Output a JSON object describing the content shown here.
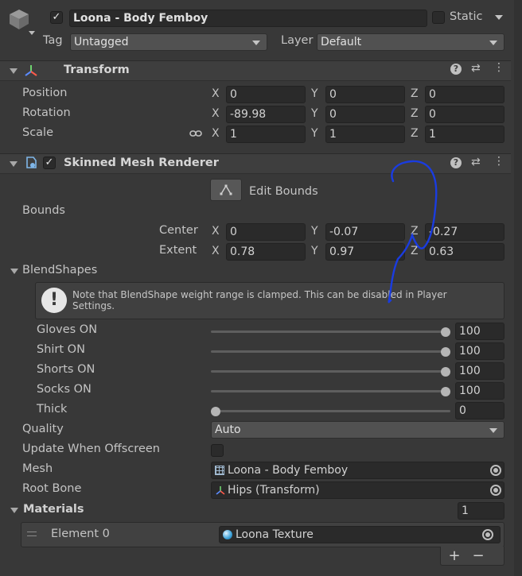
{
  "header": {
    "object_name": "Loona - Body Femboy",
    "active_checked": "✓",
    "static_label": "Static",
    "tag_label": "Tag",
    "tag_value": "Untagged",
    "layer_label": "Layer",
    "layer_value": "Default"
  },
  "transform": {
    "title": "Transform",
    "position_label": "Position",
    "rotation_label": "Rotation",
    "scale_label": "Scale",
    "x_label": "X",
    "y_label": "Y",
    "z_label": "Z",
    "position": {
      "x": "0",
      "y": "0",
      "z": "0"
    },
    "rotation": {
      "x": "-89.98",
      "y": "0",
      "z": "0"
    },
    "scale": {
      "x": "1",
      "y": "1",
      "z": "1"
    }
  },
  "renderer": {
    "title": "Skinned Mesh Renderer",
    "checked": "✓",
    "edit_bounds_label": "Edit Bounds",
    "bounds_label": "Bounds",
    "center_label": "Center",
    "extent_label": "Extent",
    "center": {
      "x": "0",
      "y": "-0.07",
      "z": "-0.27"
    },
    "extent": {
      "x": "0.78",
      "y": "0.97",
      "z": "0.63"
    },
    "blendshapes_label": "BlendShapes",
    "note": "Note that BlendShape weight range is clamped. This can be disabled in Player Settings.",
    "note_icon": "!",
    "blendshapes": [
      {
        "name": "Gloves ON",
        "value": "100",
        "level": 1.0
      },
      {
        "name": "Shirt ON",
        "value": "100",
        "level": 1.0
      },
      {
        "name": "Shorts ON",
        "value": "100",
        "level": 1.0
      },
      {
        "name": "Socks ON",
        "value": "100",
        "level": 1.0
      },
      {
        "name": "Thick",
        "value": "0",
        "level": 0.0
      }
    ],
    "quality_label": "Quality",
    "quality_value": "Auto",
    "update_offscreen_label": "Update When Offscreen",
    "mesh_label": "Mesh",
    "mesh_value": "Loona - Body Femboy",
    "root_bone_label": "Root Bone",
    "root_bone_value": "Hips (Transform)",
    "materials_label": "Materials",
    "materials_count": "1",
    "element_label": "Element 0",
    "element_value": "Loona Texture",
    "add_label": "+",
    "remove_label": "−"
  },
  "colors": {
    "background": "#383838",
    "field": "#2a2a2a",
    "annotation": "#1a3ce0"
  }
}
